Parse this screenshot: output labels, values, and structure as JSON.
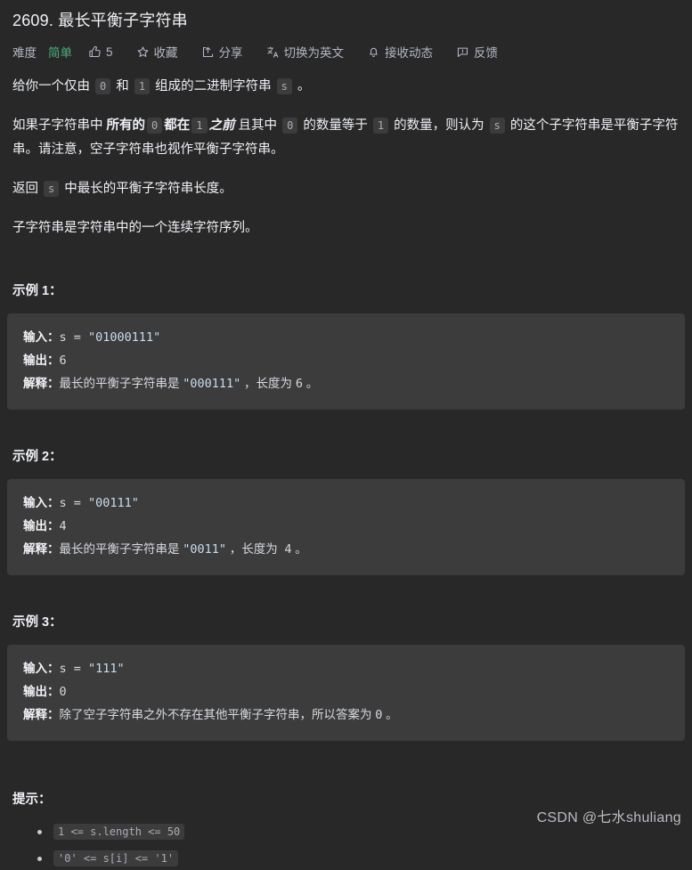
{
  "page": {
    "background": "#282828",
    "text_color": "#eff1f6",
    "code_background": "#3c3c3c",
    "accent_green": "#4caf80"
  },
  "header": {
    "title": "2609. 最长平衡子字符串",
    "toolbar": {
      "difficulty_label": "难度",
      "difficulty_value": "简单",
      "like_count": "5",
      "favorite_label": "收藏",
      "share_label": "分享",
      "translate_label": "切换为英文",
      "subscribe_label": "接收动态",
      "feedback_label": "反馈",
      "icons": {
        "like": "thumbs-up-icon",
        "favorite": "star-icon",
        "share": "share-icon",
        "translate": "translate-icon",
        "subscribe": "bell-icon",
        "feedback": "feedback-icon"
      }
    }
  },
  "description": {
    "p1": {
      "t1": "给你一个仅由 ",
      "c1": "0",
      "t2": " 和 ",
      "c2": "1",
      "t3": " 组成的二进制字符串 ",
      "c3": "s",
      "t4": " 。"
    },
    "p2": {
      "t1": "如果子字符串中 ",
      "b1": "所有的",
      "c1": "0",
      "b2": "都在",
      "c2": "1",
      "b3": "之前",
      "t2": " 且其中 ",
      "c3": "0",
      "t3": " 的数量等于 ",
      "c4": "1",
      "t4": " 的数量，则认为 ",
      "c5": "s",
      "t5": " 的这个子字符串是平衡子字符串。请注意，空子字符串也视作平衡子字符串。"
    },
    "p3": {
      "t1": "返回 ",
      "c1": "s",
      "t2": " 中最长的平衡子字符串长度。"
    },
    "p4": {
      "t1": "子字符串是字符串中的一个连续字符序列。"
    }
  },
  "examples": [
    {
      "heading": "示例 1：",
      "input_key": "输入：",
      "input_var": "s = ",
      "input_value": "\"01000111\"",
      "output_key": "输出：",
      "output_value": "6",
      "explain_key": "解释：",
      "explain_pre": "最长的平衡子字符串是 ",
      "explain_value": "\"000111\"",
      "explain_mid": " ，长度为 ",
      "explain_num": "6",
      "explain_post": " 。"
    },
    {
      "heading": "示例 2：",
      "input_key": "输入：",
      "input_var": "s = ",
      "input_value": "\"00111\"",
      "output_key": "输出：",
      "output_value": "4",
      "explain_key": "解释：",
      "explain_pre": "最长的平衡子字符串是 ",
      "explain_value": "\"0011\"",
      "explain_mid": " ，长度为  ",
      "explain_num": "4",
      "explain_post": " 。"
    },
    {
      "heading": "示例 3：",
      "input_key": "输入：",
      "input_var": "s = ",
      "input_value": "\"111\"",
      "output_key": "输出：",
      "output_value": "0",
      "explain_key": "解释：",
      "explain_pre": "除了空子字符串之外不存在其他平衡子字符串，所以答案为 ",
      "explain_value": "",
      "explain_mid": "",
      "explain_num": "0",
      "explain_post": " 。"
    }
  ],
  "hints": {
    "title": "提示：",
    "items": [
      "1 <= s.length <= 50",
      "'0' <= s[i] <= '1'"
    ]
  },
  "watermark": {
    "text": "CSDN @七水shuliang"
  }
}
